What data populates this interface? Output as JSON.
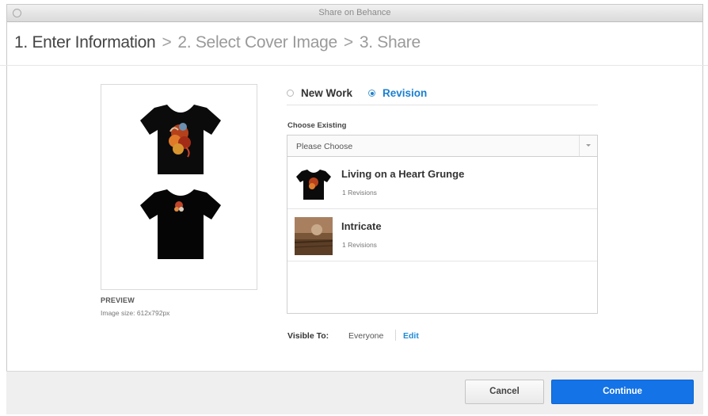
{
  "window": {
    "title": "Share on Behance"
  },
  "steps": {
    "step1": "1. Enter Information",
    "step2": "2. Select Cover Image",
    "step3": "3. Share",
    "separator": ">"
  },
  "preview": {
    "label": "PREVIEW",
    "image_size": "Image size: 612x792px"
  },
  "work_type": {
    "options": [
      {
        "label": "New Work",
        "selected": false
      },
      {
        "label": "Revision",
        "selected": true
      }
    ]
  },
  "choose_existing": {
    "label": "Choose Existing",
    "placeholder": "Please Choose",
    "items": [
      {
        "title": "Living on a Heart Grunge",
        "subtitle": "1 Revisions"
      },
      {
        "title": "Intricate",
        "subtitle": "1 Revisions"
      }
    ]
  },
  "visibility": {
    "label": "Visible To:",
    "value": "Everyone",
    "edit_label": "Edit"
  },
  "footer": {
    "cancel_label": "Cancel",
    "continue_label": "Continue"
  },
  "colors": {
    "accent": "#1a7fd0",
    "primary_button": "#1473e6"
  },
  "icons": [
    "window-close-button",
    "radio-unchecked",
    "radio-checked",
    "chevron-down-icon"
  ]
}
